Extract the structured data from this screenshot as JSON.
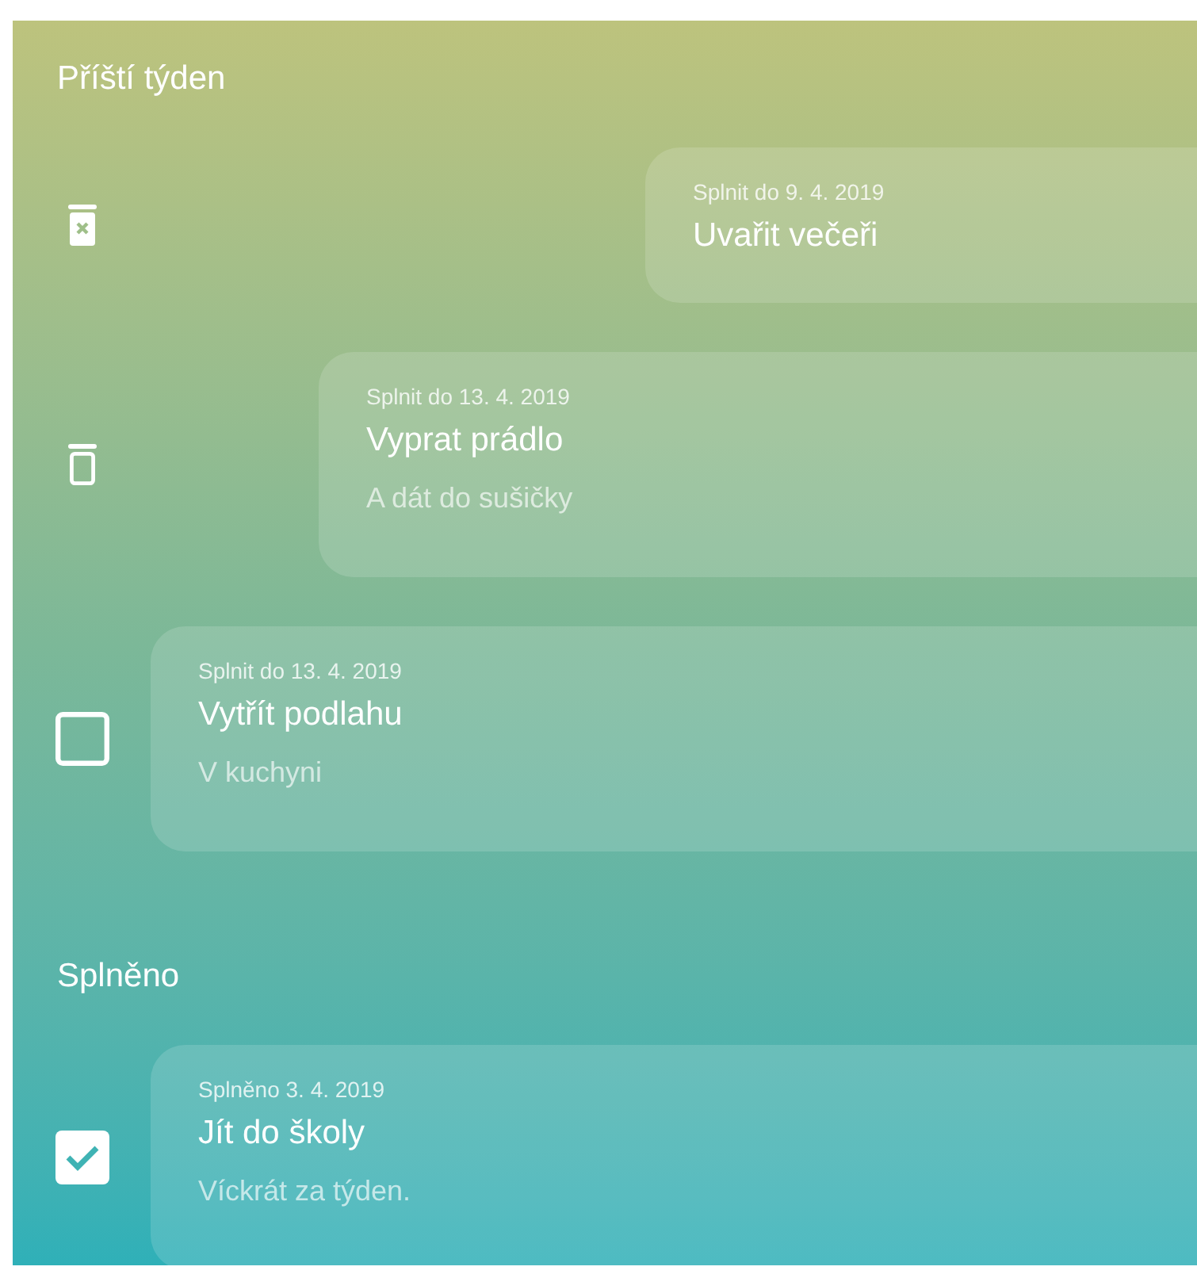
{
  "sections": [
    {
      "title": "Příští týden",
      "tasks": [
        {
          "kind": "swiped-far",
          "date": "Splnit do 9. 4. 2019",
          "title": "Uvařit večeři"
        },
        {
          "kind": "swiped",
          "date": "Splnit do 13. 4. 2019",
          "title": "Vyprat prádlo",
          "note": "A dát do sušičky"
        },
        {
          "kind": "checkbox",
          "checked": false,
          "date": "Splnit do 13. 4. 2019",
          "title": "Vytřít podlahu",
          "note": "V kuchyni"
        }
      ]
    },
    {
      "title": "Splněno",
      "tasks": [
        {
          "kind": "checkbox",
          "checked": true,
          "date": "Splněno 3. 4. 2019",
          "title": "Jít do školy",
          "note": "Víckrát za týden."
        }
      ]
    }
  ]
}
